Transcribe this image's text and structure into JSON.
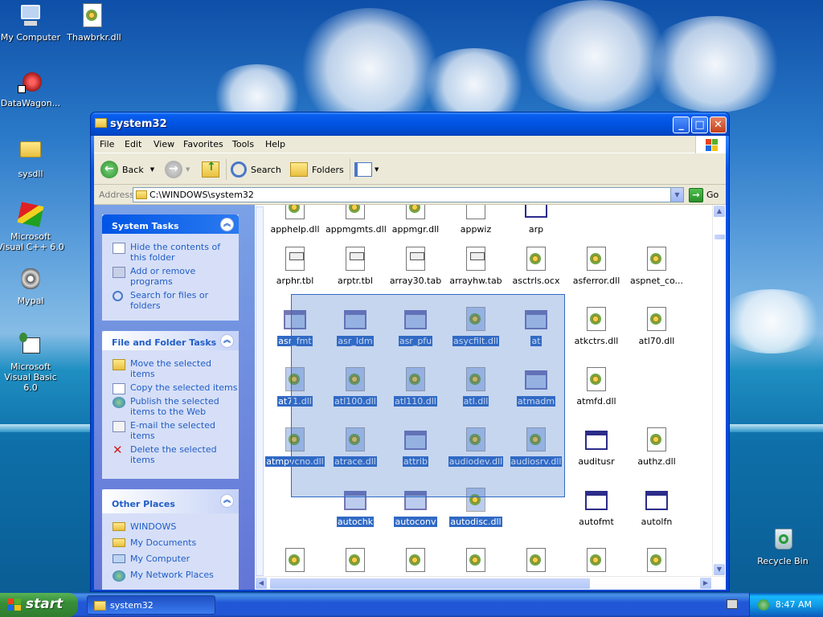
{
  "desktop": {
    "icons": [
      {
        "label": "My Computer",
        "icon": "computer-icon"
      },
      {
        "label": "Thawbrkr.dll",
        "icon": "dll-icon"
      },
      {
        "label": "DataWagon...",
        "icon": "shortcut-icon"
      },
      {
        "label": "sysdll",
        "icon": "folder-icon"
      },
      {
        "label": "Microsoft Visual C++ 6.0",
        "icon": "visual-cpp-icon"
      },
      {
        "label": "Mypal",
        "icon": "mypal-icon"
      },
      {
        "label": "Microsoft Visual Basic 6.0",
        "icon": "visual-basic-icon"
      },
      {
        "label": "Recycle Bin",
        "icon": "recycle-bin-icon"
      }
    ]
  },
  "window": {
    "title": "system32",
    "menu": [
      "File",
      "Edit",
      "View",
      "Favorites",
      "Tools",
      "Help"
    ],
    "toolbar": {
      "back": "Back",
      "search": "Search",
      "folders": "Folders"
    },
    "address": {
      "label": "Address",
      "value": "C:\\WINDOWS\\system32",
      "go": "Go"
    }
  },
  "left_pane": {
    "system_tasks": {
      "title": "System Tasks",
      "items": [
        "Hide the contents of this folder",
        "Add or remove programs",
        "Search for files or folders"
      ]
    },
    "file_folder_tasks": {
      "title": "File and Folder Tasks",
      "items": [
        "Move the selected items",
        "Copy the selected items",
        "Publish the selected items to the Web",
        "E-mail the selected items",
        "Delete the selected items"
      ]
    },
    "other_places": {
      "title": "Other Places",
      "items": [
        "WINDOWS",
        "My Documents",
        "My Computer",
        "My Network Places"
      ]
    }
  },
  "files": {
    "rows": [
      [
        {
          "name": "apphelp.dll",
          "type": "dll"
        },
        {
          "name": "appmgmts.dll",
          "type": "dll"
        },
        {
          "name": "appmgr.dll",
          "type": "dll"
        },
        {
          "name": "appwiz",
          "type": "doc"
        },
        {
          "name": "arp",
          "type": "exe"
        }
      ],
      [
        {
          "name": "arphr.tbl",
          "type": "tbl"
        },
        {
          "name": "arptr.tbl",
          "type": "tbl"
        },
        {
          "name": "array30.tab",
          "type": "tbl"
        },
        {
          "name": "arrayhw.tab",
          "type": "tbl"
        },
        {
          "name": "asctrls.ocx",
          "type": "dll"
        },
        {
          "name": "asferror.dll",
          "type": "dll"
        },
        {
          "name": "aspnet_co...",
          "type": "dll"
        }
      ],
      [
        {
          "name": "asr_fmt",
          "type": "exe",
          "sel": true
        },
        {
          "name": "asr_ldm",
          "type": "exe",
          "sel": true
        },
        {
          "name": "asr_pfu",
          "type": "exe",
          "sel": true
        },
        {
          "name": "asycfilt.dll",
          "type": "dll",
          "sel": true
        },
        {
          "name": "at",
          "type": "exe",
          "sel": true
        },
        {
          "name": "atkctrs.dll",
          "type": "dll"
        },
        {
          "name": "atl70.dll",
          "type": "dll"
        }
      ],
      [
        {
          "name": "at71.dll",
          "type": "dll",
          "sel": true
        },
        {
          "name": "atl100.dll",
          "type": "dll",
          "sel": true
        },
        {
          "name": "atl110.dll",
          "type": "dll",
          "sel": true
        },
        {
          "name": "atl.dll",
          "type": "dll",
          "sel": true
        },
        {
          "name": "atmadm",
          "type": "exe",
          "sel": true
        },
        {
          "name": "atmfd.dll",
          "type": "dll"
        }
      ],
      [
        {
          "name": "atmpvcno.dll",
          "type": "dll",
          "sel": true
        },
        {
          "name": "atrace.dll",
          "type": "dll",
          "sel": true
        },
        {
          "name": "attrib",
          "type": "exe",
          "sel": true
        },
        {
          "name": "audiodev.dll",
          "type": "dll",
          "sel": true
        },
        {
          "name": "audiosrv.dll",
          "type": "dll",
          "sel": true
        },
        {
          "name": "auditusr",
          "type": "exe"
        },
        {
          "name": "authz.dll",
          "type": "dll"
        }
      ],
      [
        {
          "name": "",
          "type": "none"
        },
        {
          "name": "autochk",
          "type": "exe",
          "sel": true
        },
        {
          "name": "autoconv",
          "type": "exe",
          "sel": true
        },
        {
          "name": "autodisc.dll",
          "type": "dll",
          "sel": true
        },
        {
          "name": "",
          "type": "none"
        },
        {
          "name": "autofmt",
          "type": "exe"
        },
        {
          "name": "autolfn",
          "type": "exe"
        }
      ],
      [
        {
          "name": "",
          "type": "dll"
        },
        {
          "name": "",
          "type": "dll"
        },
        {
          "name": "",
          "type": "dll"
        },
        {
          "name": "",
          "type": "dll"
        },
        {
          "name": "",
          "type": "dll"
        },
        {
          "name": "",
          "type": "dll"
        },
        {
          "name": "",
          "type": "dll"
        }
      ]
    ]
  },
  "taskbar": {
    "start": "start",
    "task": "system32",
    "clock": "8:47 AM"
  },
  "colors": {
    "selection": "#316ac5",
    "titlebar": "#0053e1",
    "link": "#215dc6"
  }
}
